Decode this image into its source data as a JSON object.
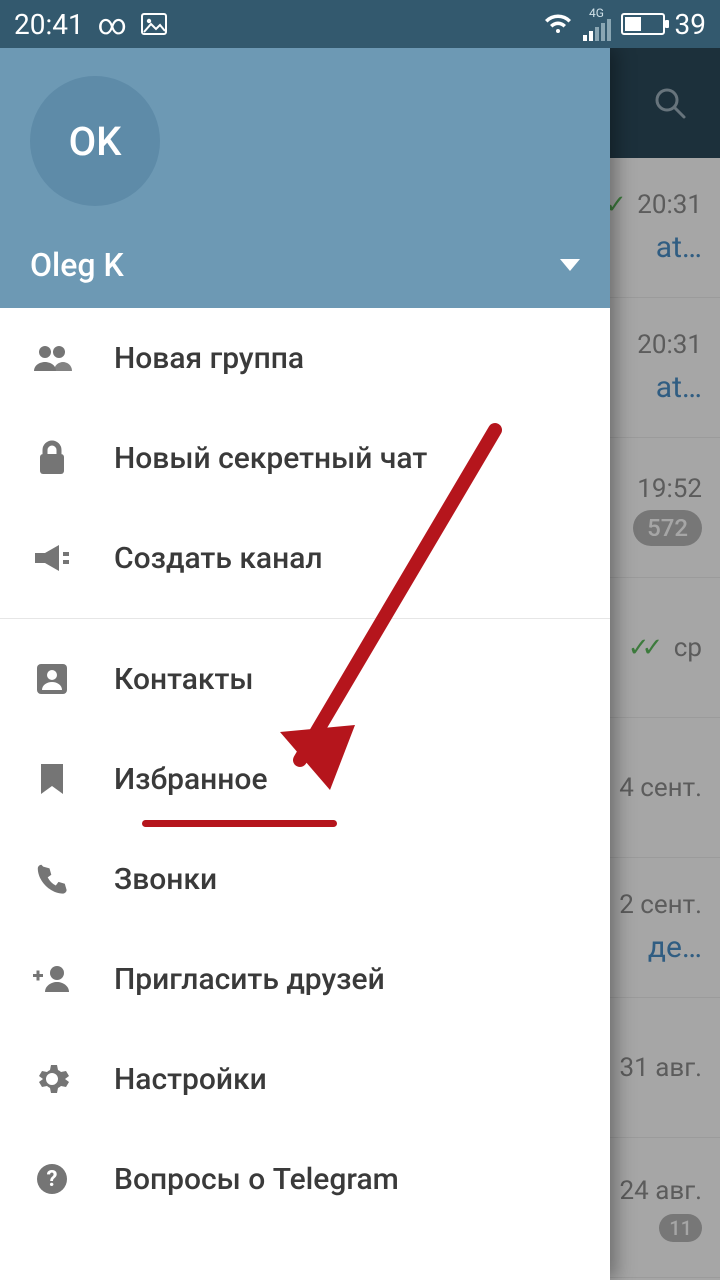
{
  "status": {
    "time": "20:41",
    "network_label": "4G",
    "battery": "39"
  },
  "drawer": {
    "avatar_initials": "OK",
    "account_name": "Oleg K",
    "items": [
      {
        "label": "Новая группа"
      },
      {
        "label": "Новый секретный чат"
      },
      {
        "label": "Создать канал"
      },
      {
        "label": "Контакты"
      },
      {
        "label": "Избранное"
      },
      {
        "label": "Звонки"
      },
      {
        "label": "Пригласить друзей"
      },
      {
        "label": "Настройки"
      },
      {
        "label": "Вопросы о Telegram"
      }
    ]
  },
  "chats": [
    {
      "time": "20:31",
      "sub": "at…",
      "checks": true
    },
    {
      "time": "20:31",
      "sub": "at…"
    },
    {
      "time": "19:52",
      "badge": "572"
    },
    {
      "time": "ср",
      "checks": true
    },
    {
      "time": "4 сент."
    },
    {
      "time": "2 сент.",
      "sub": "де…"
    },
    {
      "time": "31 авг."
    },
    {
      "time": "24 авг.",
      "badge": "11"
    }
  ]
}
